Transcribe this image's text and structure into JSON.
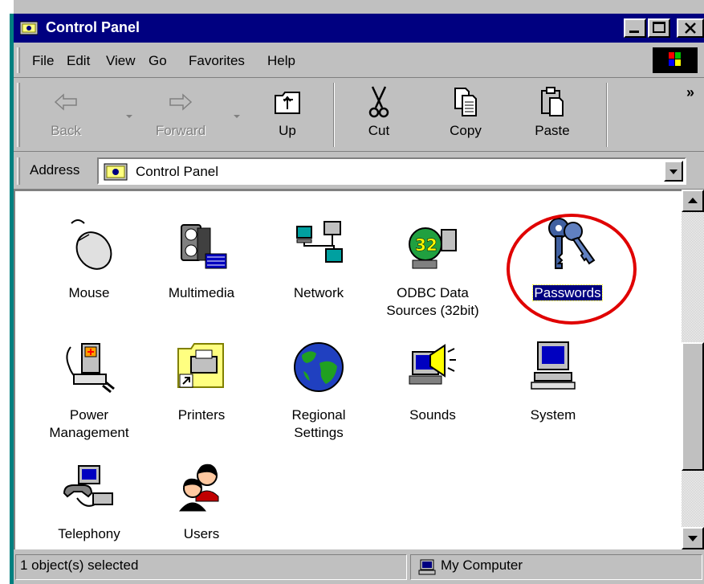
{
  "window": {
    "title": "Control Panel"
  },
  "menu": [
    "File",
    "Edit",
    "View",
    "Go",
    "Favorites",
    "Help"
  ],
  "toolbar": {
    "back": "Back",
    "forward": "Forward",
    "up": "Up",
    "cut": "Cut",
    "copy": "Copy",
    "paste": "Paste",
    "more": "»"
  },
  "address": {
    "label": "Address",
    "value": "Control Panel"
  },
  "items": [
    {
      "label": "Mouse",
      "icon": "mouse-icon"
    },
    {
      "label": "Multimedia",
      "icon": "multimedia-icon"
    },
    {
      "label": "Network",
      "icon": "network-icon"
    },
    {
      "label": "ODBC Data Sources (32bit)",
      "icon": "odbc-icon"
    },
    {
      "label": "Passwords",
      "icon": "keys-icon",
      "selected": true
    },
    {
      "label": "Power Management",
      "icon": "power-icon"
    },
    {
      "label": "Printers",
      "icon": "printers-folder-icon"
    },
    {
      "label": "Regional Settings",
      "icon": "globe-icon"
    },
    {
      "label": "Sounds",
      "icon": "speaker-icon"
    },
    {
      "label": "System",
      "icon": "computer-icon"
    },
    {
      "label": "Telephony",
      "icon": "telephone-icon"
    },
    {
      "label": "Users",
      "icon": "users-icon"
    }
  ],
  "status": {
    "left": "1 object(s) selected",
    "right": "My Computer"
  },
  "colors": {
    "titlebar": "#000080",
    "selection": "#000080",
    "annotation": "#e00000"
  }
}
